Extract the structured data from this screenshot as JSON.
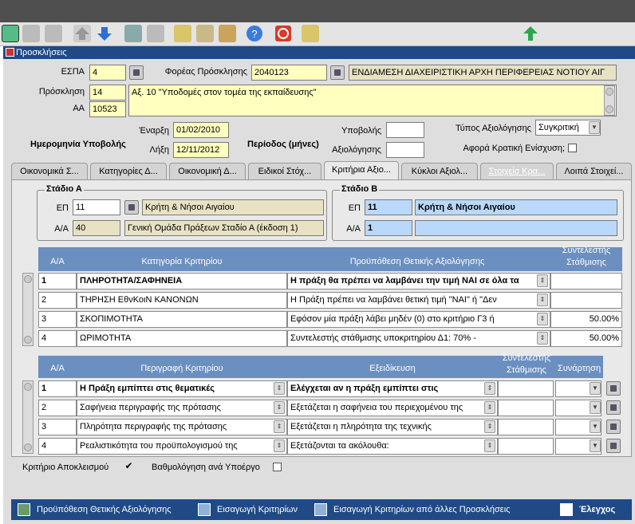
{
  "toolbar": {
    "icons": [
      "exit-icon",
      "grid-icon",
      "grid2-icon",
      "up-arrow-icon",
      "down-arrow-icon",
      "print-icon",
      "print-preview-icon",
      "edit-icon",
      "copy-icon",
      "paste-icon",
      "help-icon",
      "stop-icon",
      "attach-icon",
      "navigate-icon"
    ]
  },
  "window": {
    "title": "Προσκλήσεις"
  },
  "form": {
    "espa_label": "ΕΣΠΑ",
    "espa_value": "4",
    "foreas_label": "Φορέας Πρόσκλησης",
    "foreas_code": "2040123",
    "foreas_name": "ΕΝΔΙΑΜΕΣΗ ΔΙΑΧΕΙΡΙΣΤΙΚΗ ΑΡΧΗ ΠΕΡΙΦΕΡΕΙΑΣ ΝΟΤΙΟΥ ΑΙΓ",
    "prosklisi_label": "Πρόσκληση",
    "prosklisi_value": "14",
    "prosklisi_text": "Αξ. 10 \"Υποδομές στον τομέα της εκπαίδευσης\"",
    "aa_label": "ΑΑ",
    "aa_value": "10523",
    "date_submit_label": "Ημερομηνία Υποβολής",
    "start_label": "Έναρξη",
    "start_value": "01/02/2010",
    "end_label": "Λήξη",
    "end_value": "12/11/2012",
    "period_label": "Περίοδος (μήνες)",
    "submit_label": "Υποβολής",
    "submit_value": "",
    "eval_label": "Αξιολόγησης",
    "eval_value": "",
    "eval_type_label": "Τύπος Αξιολόγησης",
    "eval_type_value": "Συγκριτική",
    "state_aid_label": "Αφορά Κρατική  Ενίσχυση;"
  },
  "tabs": [
    {
      "label": "Οικονομικά Σ..."
    },
    {
      "label": "Κατηγορίες Δ..."
    },
    {
      "label": "Οικονομική Δ..."
    },
    {
      "label": "Ειδικοί Στόχ..."
    },
    {
      "label": "Κριτήρια Αξιο..."
    },
    {
      "label": "Κύκλοι Αξιολ..."
    },
    {
      "label": "Στοιχεία Κρα..."
    },
    {
      "label": "Λοιπά Στοιχεί..."
    }
  ],
  "stageA": {
    "title": "Στάδιο Α",
    "ep_label": "ΕΠ",
    "ep_code": "11",
    "ep_name": "Κρήτη & Νήσοι Αιγαίου",
    "aa_label": "Α/Α",
    "aa_code": "40",
    "aa_name": "Γενική Ομάδα Πράξεων Σταδίο Α (έκδοση 1)"
  },
  "stageB": {
    "title": "Στάδιο Β",
    "ep_label": "ΕΠ",
    "ep_code": "11",
    "ep_name": "Κρήτη & Νήσοι Αιγαίου",
    "aa_label": "Α/Α",
    "aa_code": "1",
    "aa_name": ""
  },
  "table1": {
    "headers": {
      "aa": "Α/Α",
      "category": "Κατηγορία Κριτηρίου",
      "condition": "Προϋπόθεση Θετικής Αξιολόγησης",
      "weight": "Συντελεστής Στάθμισης"
    },
    "rows": [
      {
        "aa": "1",
        "category": "ΠΛΗΡΟΤΗΤΑ/ΣΑΦΗΝΕΙΑ",
        "condition": "Η πράξη θα πρέπει να λαμβάνει την τιμή ΝΑΙ σε όλα τα",
        "weight": ""
      },
      {
        "aa": "2",
        "category": "ΤΗΡΗΣΗ ΕθνΚοιΝ ΚΑΝΟΝΩΝ",
        "condition": "Η Πράξη πρέπει να λαμβάνει θετική τιμή \"ΝΑΙ\" ή \"Δεν",
        "weight": ""
      },
      {
        "aa": "3",
        "category": "ΣΚΟΠΙΜΟΤΗΤΑ",
        "condition": "Εφόσον μία πράξη λάβει μηδέν (0) στο κριτήριο Γ3 ή",
        "weight": "50.00%"
      },
      {
        "aa": "4",
        "category": "ΩΡΙΜΟΤΗΤΑ",
        "condition": "Συντελεστής στάθμισης υποκριτηρίου Δ1: 70% -",
        "weight": "50.00%"
      }
    ]
  },
  "table2": {
    "headers": {
      "aa": "Α/Α",
      "description": "Περιγραφή Κριτηρίου",
      "spec": "Εξειδίκευση",
      "weight": "Συντελεστής Στάθμισης",
      "function": "Συνάρτηση"
    },
    "rows": [
      {
        "aa": "1",
        "description": "Η Πράξη εμπίπτει στις θεματικές",
        "spec": "Ελέγχεται αν η πράξη εμπίπτει στις",
        "weight": ""
      },
      {
        "aa": "2",
        "description": "Σαφήνεια περιγραφής της πρότασης",
        "spec": "Εξετάζεται η σαφήνεια του περιεχομένου της",
        "weight": ""
      },
      {
        "aa": "3",
        "description": "Πληρότητα περιγραφής της πρότασης",
        "spec": "Εξετάζεται η πληρότητα της τεχνικής",
        "weight": ""
      },
      {
        "aa": "4",
        "description": "Ρεαλιστικότητα του προϋπολογισμού της",
        "spec": "Εξετάζονται τα ακόλουθα:",
        "weight": ""
      }
    ]
  },
  "options": {
    "exclusion_label": "Κριτήριο Αποκλεισμού",
    "exclusion_checked": "✔",
    "subgroup_label": "Βαθμολόγηση ανά Υποέργο"
  },
  "bottom": {
    "positive_condition": "Προϋπόθεση Θετικής Αξιολόγησης",
    "insert_criteria": "Εισαγωγή Κριτηρίων",
    "insert_other": "Εισαγωγή Κριτηρίων από άλλες Προσκλήσεις",
    "check": "Έλεγχος"
  }
}
